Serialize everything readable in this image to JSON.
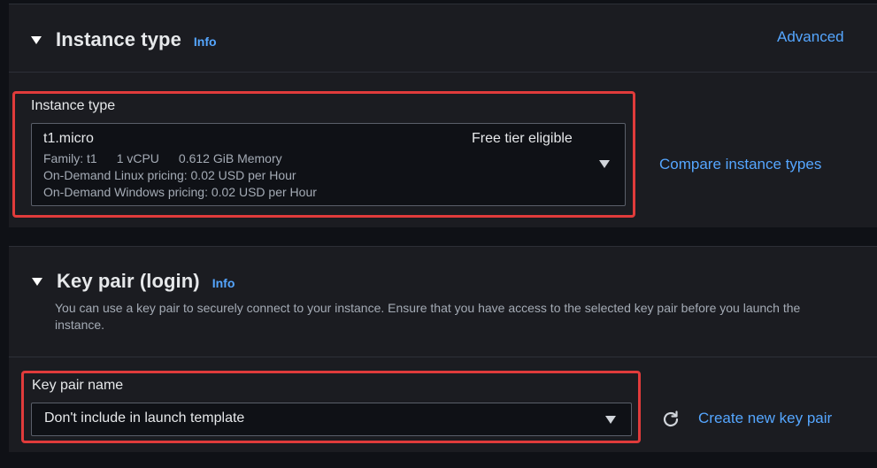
{
  "instance_type_section": {
    "title": "Instance type",
    "info_label": "Info",
    "advanced_label": "Advanced",
    "field_label": "Instance type",
    "selected": {
      "name": "t1.micro",
      "badge": "Free tier eligible",
      "family": "Family: t1",
      "vcpu": "1 vCPU",
      "memory": "0.612 GiB Memory",
      "linux_pricing": "On-Demand Linux pricing: 0.02 USD per Hour",
      "windows_pricing": "On-Demand Windows pricing: 0.02 USD per Hour"
    },
    "compare_label": "Compare instance types"
  },
  "key_pair_section": {
    "title": "Key pair (login)",
    "info_label": "Info",
    "description": "You can use a key pair to securely connect to your instance. Ensure that you have access to the selected key pair before you launch the instance.",
    "field_label": "Key pair name",
    "selected_value": "Don't include in launch template",
    "create_label": "Create new key pair"
  },
  "colors": {
    "link": "#55a6ff",
    "highlight": "#e03b3b",
    "panel_bg": "#1b1c21",
    "page_bg": "#0f1116"
  },
  "icons": {
    "section_toggle": "caret-down-icon",
    "dropdown": "triangle-down-icon",
    "refresh": "refresh-icon"
  }
}
